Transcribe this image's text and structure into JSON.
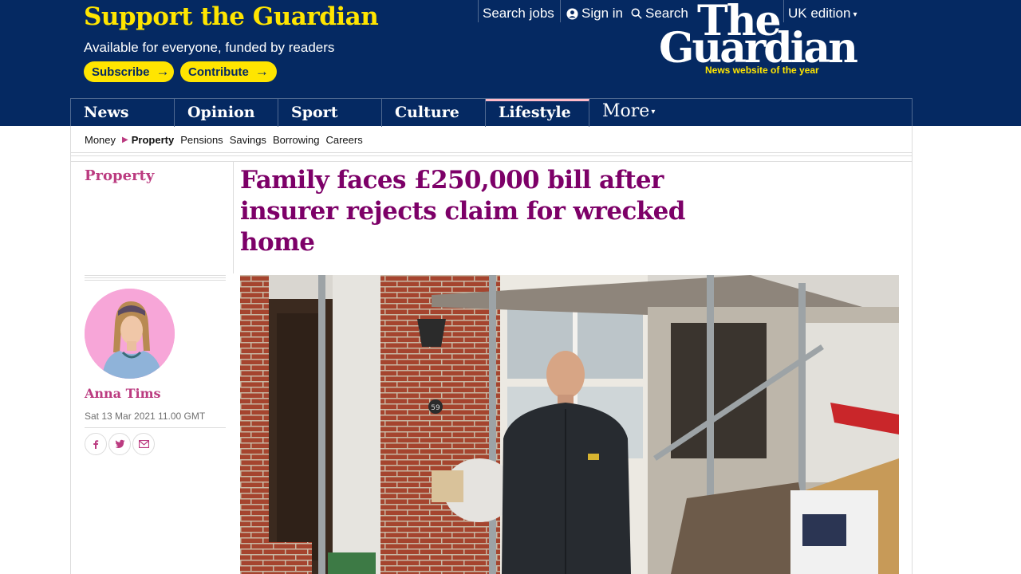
{
  "support": {
    "title": "Support the Guardian",
    "subtitle": "Available for everyone, funded by readers",
    "subscribe_label": "Subscribe",
    "contribute_label": "Contribute"
  },
  "toplinks": {
    "search_jobs": "Search jobs",
    "sign_in": "Sign in",
    "search": "Search",
    "edition": "UK edition"
  },
  "logo": {
    "line1": "The",
    "line2": "Guardian",
    "tagline": "News website of the year"
  },
  "pillars": [
    {
      "label": "News",
      "active": false
    },
    {
      "label": "Opinion",
      "active": false
    },
    {
      "label": "Sport",
      "active": false
    },
    {
      "label": "Culture",
      "active": false
    },
    {
      "label": "Lifestyle",
      "active": true
    }
  ],
  "more_label": "More",
  "subnav": {
    "parent": "Money",
    "current": "Property",
    "items": [
      "Pensions",
      "Savings",
      "Borrowing",
      "Careers"
    ]
  },
  "article": {
    "section": "Property",
    "headline": "Family faces £250,000 bill after insurer rejects claim for wrecked home",
    "author": "Anna Tims",
    "date": "Sat 13 Mar 2021 11.00 GMT",
    "house_number": "59"
  },
  "share_icons": [
    "facebook-icon",
    "twitter-icon",
    "email-icon"
  ],
  "colors": {
    "brand_blue": "#052962",
    "yellow": "#ffe500",
    "lifestyle_headline": "#7d0068",
    "lifestyle_accent": "#bb3b80"
  }
}
